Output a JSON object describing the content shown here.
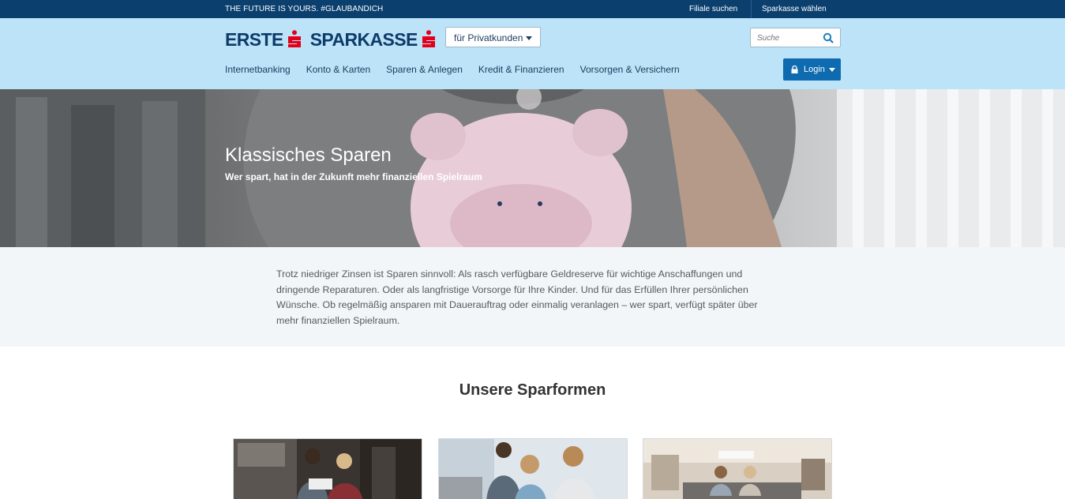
{
  "topbar": {
    "claim": "THE FUTURE IS YOURS. #GLAUBANDICH",
    "links": {
      "filiale": "Filiale suchen",
      "sparkasse": "Sparkasse wählen"
    }
  },
  "header": {
    "logo": {
      "word1": "ERSTE",
      "word2": "SPARKASSE"
    },
    "segment": {
      "label": "für  Privatkunden"
    },
    "search": {
      "placeholder": "Suche"
    },
    "nav": [
      "Internetbanking",
      "Konto & Karten",
      "Sparen & Anlegen",
      "Kredit & Finanzieren",
      "Vorsorgen & Versichern"
    ],
    "login": {
      "label": "Login"
    }
  },
  "hero": {
    "title": "Klassisches Sparen",
    "subtitle": "Wer spart, hat in der Zukunft mehr finanziellen Spielraum"
  },
  "intro": {
    "text": "Trotz niedriger Zinsen ist Sparen sinnvoll: Als rasch verfügbare Geldreserve für wichtige Anschaffungen und dringende Reparaturen. Oder als langfristige Vorsorge für Ihre Kinder. Und für das Erfüllen Ihrer persönlichen Wünsche. Ob regelmäßig ansparen mit Dauerauftrag oder einmalig veranlagen – wer spart, verfügt später über mehr finanziellen Spielraum."
  },
  "section": {
    "title": "Unsere Sparformen"
  },
  "colors": {
    "topbar": "#0b3f6e",
    "header": "#bde3f8",
    "brand_red": "#e2001a",
    "brand_blue": "#0d3c6a",
    "login": "#0e6bb0"
  }
}
